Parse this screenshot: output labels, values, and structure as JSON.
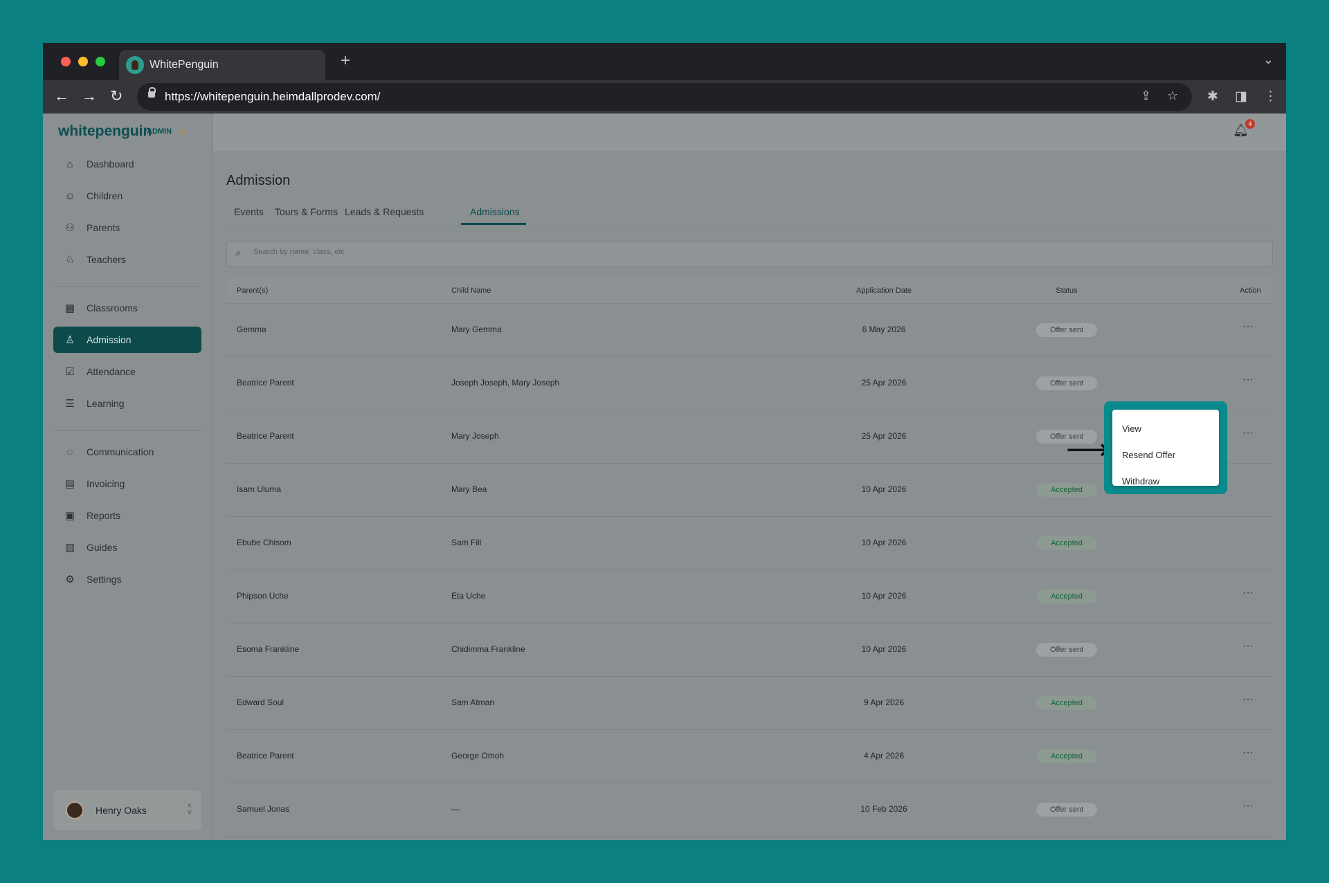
{
  "browser": {
    "tab_title": "WhitePenguin",
    "url": "https://whitepenguin.heimdallprodev.com/"
  },
  "brand": {
    "logo": "whitepenguin",
    "role": "ADMIN"
  },
  "sidebar": {
    "items": [
      {
        "label": "Dashboard",
        "icon": "home-icon"
      },
      {
        "label": "Children",
        "icon": "child-icon"
      },
      {
        "label": "Parents",
        "icon": "users-icon"
      },
      {
        "label": "Teachers",
        "icon": "teacher-icon"
      },
      {
        "label": "Classrooms",
        "icon": "grid-icon"
      },
      {
        "label": "Admission",
        "icon": "user-add-icon",
        "active": true
      },
      {
        "label": "Attendance",
        "icon": "check-square-icon"
      },
      {
        "label": "Learning",
        "icon": "book-icon"
      },
      {
        "label": "Communication",
        "icon": "chat-icon"
      },
      {
        "label": "Invoicing",
        "icon": "receipt-icon"
      },
      {
        "label": "Reports",
        "icon": "chart-icon"
      },
      {
        "label": "Guides",
        "icon": "document-icon"
      },
      {
        "label": "Settings",
        "icon": "gear-icon"
      }
    ],
    "user": {
      "name": "Henry Oaks"
    }
  },
  "header": {
    "notification_count": "4"
  },
  "page": {
    "title": "Admission",
    "tabs": [
      {
        "label": "Events"
      },
      {
        "label": "Tours & Forms"
      },
      {
        "label": "Leads & Requests"
      },
      {
        "label": "Admissions",
        "active": true
      }
    ],
    "search_placeholder": "Search by name, class, etc"
  },
  "table": {
    "headers": {
      "parent": "Parent(s)",
      "child": "Child Name",
      "date": "Application Date",
      "status": "Status",
      "action": "Action"
    },
    "rows": [
      {
        "parent": "Gemma",
        "child": "Mary Gemma",
        "date": "6 May 2026",
        "status": "Offer sent"
      },
      {
        "parent": "Beatrice Parent",
        "child": "Joseph Joseph, Mary Joseph",
        "date": "25 Apr 2026",
        "status": "Offer sent"
      },
      {
        "parent": "Beatrice Parent",
        "child": "Mary Joseph",
        "date": "25 Apr 2026",
        "status": "Offer sent"
      },
      {
        "parent": "Isam Uluma",
        "child": "Mary Bea",
        "date": "10 Apr 2026",
        "status": "Accepted"
      },
      {
        "parent": "Ebube Chisom",
        "child": "Sam Fill",
        "date": "10 Apr 2026",
        "status": "Accepted"
      },
      {
        "parent": "Phipson Uche",
        "child": "Eta Uche",
        "date": "10 Apr 2026",
        "status": "Accepted"
      },
      {
        "parent": "Esoma Frankline",
        "child": "Chidimma Frankline",
        "date": "10 Apr 2026",
        "status": "Offer sent"
      },
      {
        "parent": "Edward Soul",
        "child": "Sam Atman",
        "date": "9 Apr 2026",
        "status": "Accepted"
      },
      {
        "parent": "Beatrice Parent",
        "child": "George Omoh",
        "date": "4 Apr 2026",
        "status": "Accepted"
      },
      {
        "parent": "Samuel Jonas",
        "child": "—",
        "date": "10 Feb 2026",
        "status": "Offer sent"
      }
    ],
    "action_label": "···"
  },
  "action_menu": {
    "items": [
      "View",
      "Resend Offer",
      "Withdraw"
    ]
  },
  "colors": {
    "background": "#0b8081",
    "accent": "#0d4a4c",
    "accepted": "#15643b",
    "highlight": "#0a8a8c"
  }
}
